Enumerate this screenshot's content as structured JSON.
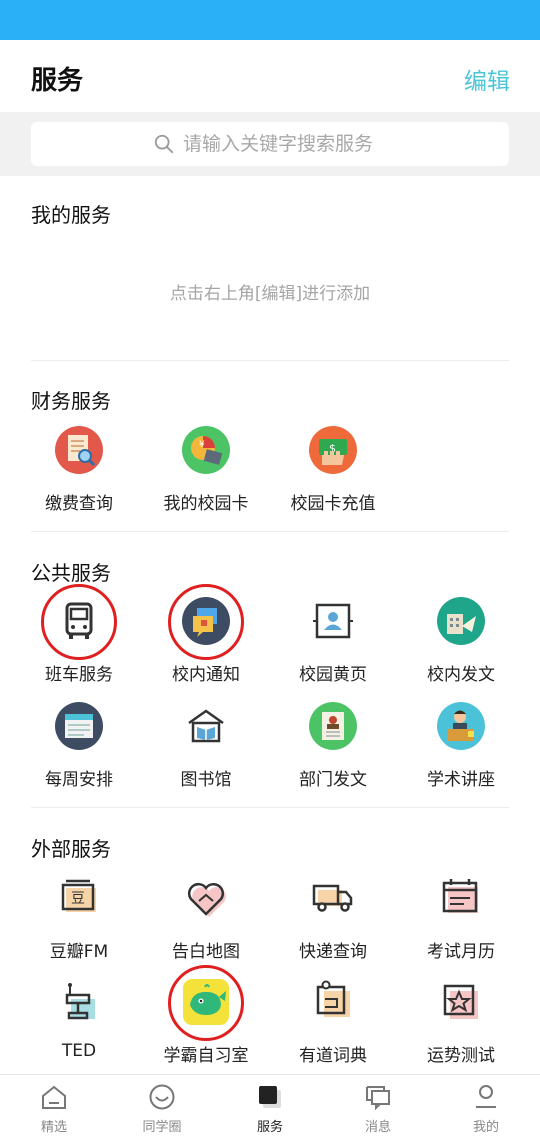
{
  "header": {
    "title": "服务",
    "edit_label": "编辑"
  },
  "search": {
    "placeholder": "请输入关键字搜索服务"
  },
  "my_services": {
    "title": "我的服务",
    "hint": "点击右上角[编辑]进行添加"
  },
  "finance": {
    "title": "财务服务",
    "items": [
      {
        "label": "缴费查询",
        "icon": "bill-search-icon"
      },
      {
        "label": "我的校园卡",
        "icon": "campus-card-icon"
      },
      {
        "label": "校园卡充值",
        "icon": "card-recharge-icon"
      }
    ]
  },
  "public": {
    "title": "公共服务",
    "items": [
      {
        "label": "班车服务",
        "icon": "bus-icon",
        "highlighted": true
      },
      {
        "label": "校内通知",
        "icon": "notice-icon",
        "highlighted": true
      },
      {
        "label": "校园黄页",
        "icon": "yellow-pages-icon"
      },
      {
        "label": "校内发文",
        "icon": "document-icon"
      },
      {
        "label": "每周安排",
        "icon": "weekly-schedule-icon"
      },
      {
        "label": "图书馆",
        "icon": "library-icon"
      },
      {
        "label": "部门发文",
        "icon": "department-doc-icon"
      },
      {
        "label": "学术讲座",
        "icon": "lecture-icon"
      }
    ]
  },
  "external": {
    "title": "外部服务",
    "items": [
      {
        "label": "豆瓣FM",
        "icon": "radio-icon"
      },
      {
        "label": "告白地图",
        "icon": "heart-icon"
      },
      {
        "label": "快递查询",
        "icon": "truck-icon"
      },
      {
        "label": "考试月历",
        "icon": "calendar-icon"
      },
      {
        "label": "TED",
        "icon": "podium-icon"
      },
      {
        "label": "学霸自习室",
        "icon": "whale-icon",
        "highlighted": true
      },
      {
        "label": "有道词典",
        "icon": "dictionary-icon"
      },
      {
        "label": "运势测试",
        "icon": "fortune-star-icon"
      }
    ]
  },
  "nav": {
    "tabs": [
      {
        "label": "精选",
        "icon": "home-icon"
      },
      {
        "label": "同学圈",
        "icon": "smile-icon"
      },
      {
        "label": "服务",
        "icon": "service-icon",
        "active": true
      },
      {
        "label": "消息",
        "icon": "message-icon"
      },
      {
        "label": "我的",
        "icon": "profile-icon"
      }
    ]
  },
  "colors": {
    "status_bar": "#2ab0f6",
    "accent": "#4cc6d6",
    "highlight_ring": "#e02020"
  }
}
